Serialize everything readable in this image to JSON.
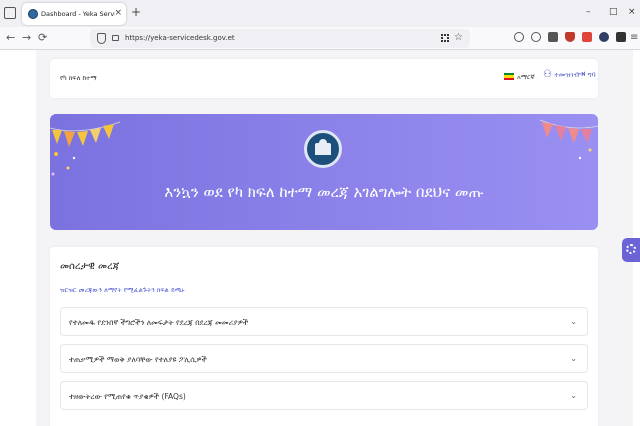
{
  "browser": {
    "tab_title": "Dashboard - Yeka Service Desk",
    "url": "https://yeka-servicedesk.gov.et",
    "new_tab_icon": "+",
    "close_tab_icon": "×",
    "minimize_icon": "–",
    "maximize_icon": "□",
    "close_window_icon": "×",
    "back_icon": "←",
    "forward_icon": "→",
    "reload_icon": "⟳"
  },
  "header": {
    "site_name": "የካ ክፍለ ከተማ",
    "language": "አማርኛ",
    "signup_label": "ተመዝገብ",
    "login_label": "ግባ",
    "flag_colors": [
      "#078930",
      "#fcdd09",
      "#da121a"
    ]
  },
  "hero": {
    "title": "እንኳን ወደ የካ ክፍለ ከተማ መረጃ አገልግሎት በደህና መጡ",
    "colors": {
      "start": "#7b72e0",
      "end": "#9a90f2"
    }
  },
  "info": {
    "title": "መሰረታዊ መረጃ",
    "link_text": "ዝርዝር መረጃውን ለማየት የሚፈልጉትን ክፍል ይጫኑ",
    "items": [
      {
        "label": "የተለመዱ የደንበኛ ችግሮችን ለመፍታት የደረጃ በደረጃ መመሪያዎች"
      },
      {
        "label": "ተጠቃሚዎች ማወቅ ያለባቸው የተለያዩ ፖሊሲዎች"
      },
      {
        "label": "ተዘውትረው የሚጠየቁ ጥያቄዎች (FAQs)"
      }
    ],
    "chevron": "⌄"
  },
  "accent_color": "#6c63d6"
}
